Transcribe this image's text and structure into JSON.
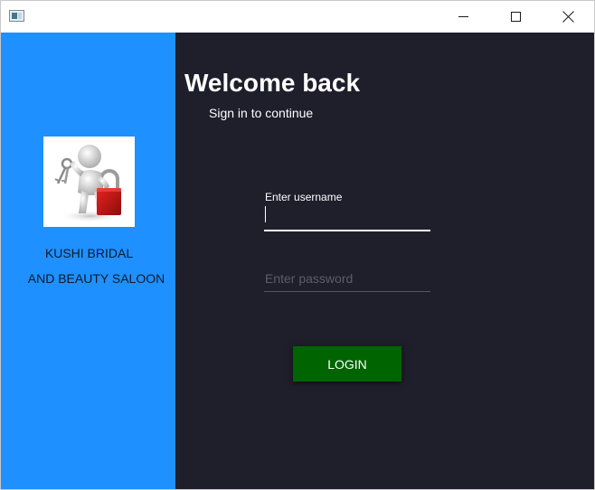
{
  "window": {
    "icon": "app-window-icon",
    "controls": [
      "minimize-icon",
      "maximize-icon",
      "close-icon"
    ]
  },
  "sidebar": {
    "logo_icon": "person-with-keys-and-padlock-icon",
    "brand_line1": "KUSHI BRIDAL",
    "brand_line2": "AND BEAUTY SALOON",
    "background": "#1e90ff"
  },
  "login": {
    "title": "Welcome back",
    "subtitle": "Sign in to continue",
    "username_label": "Enter username",
    "username_value": "",
    "password_placeholder": "Enter password",
    "password_value": "",
    "button_label": "LOGIN",
    "background": "#1f1e2b",
    "button_color": "#006400"
  }
}
